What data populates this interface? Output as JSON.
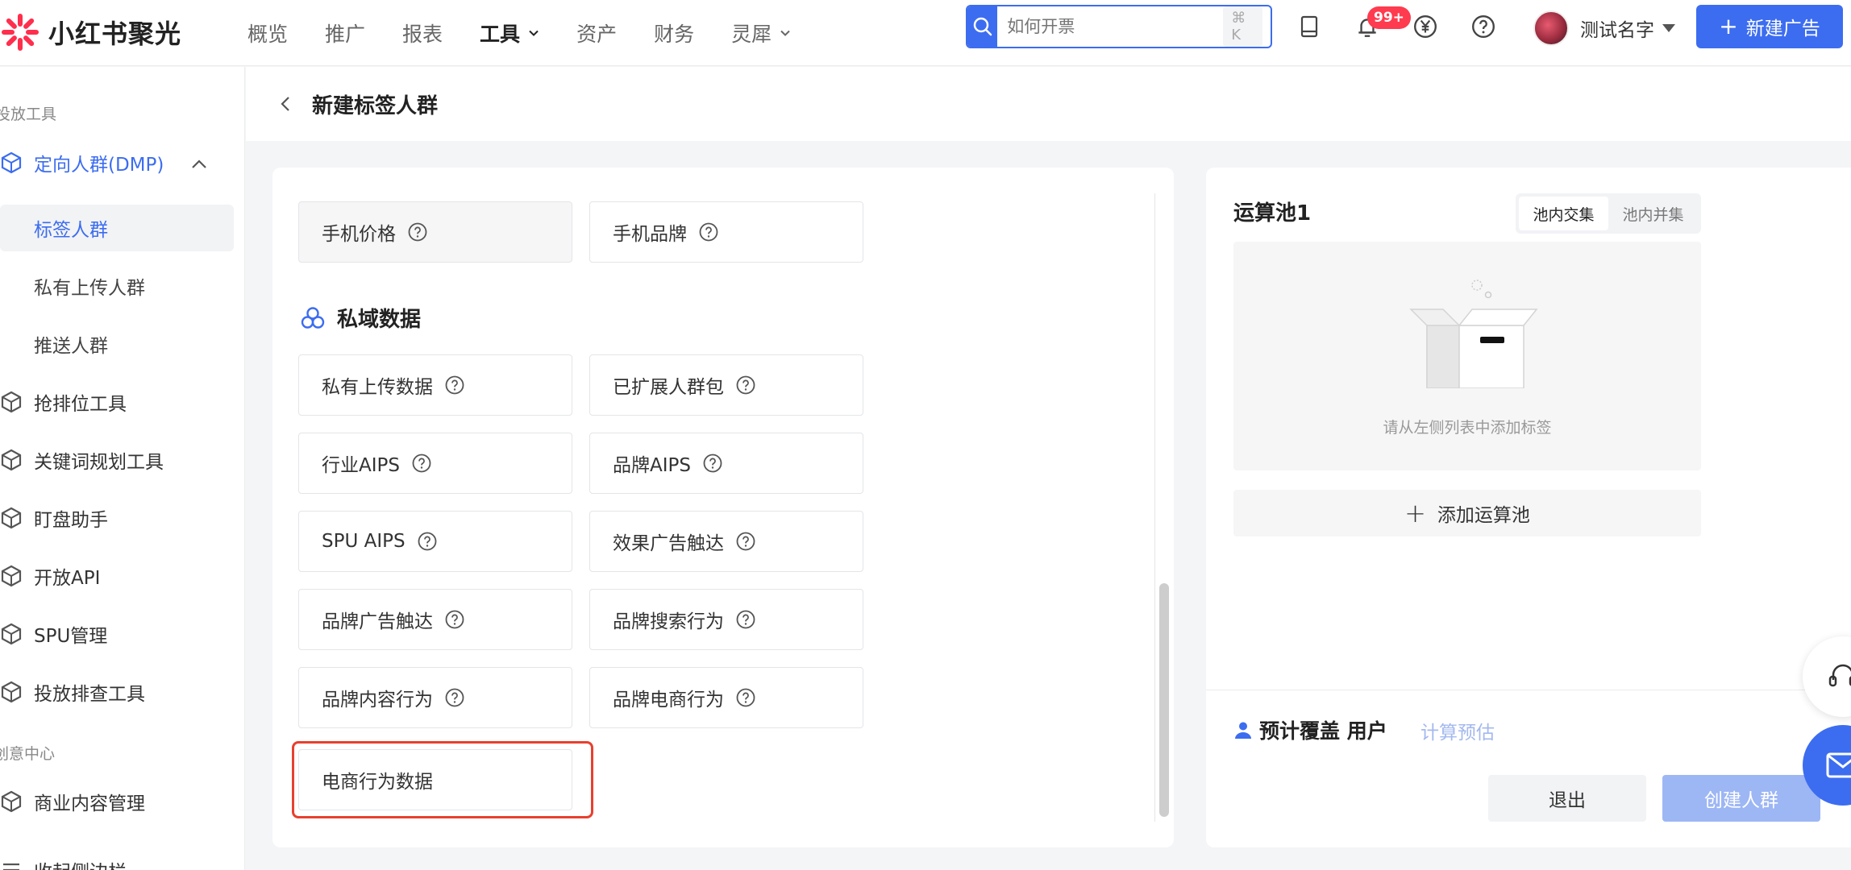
{
  "app": {
    "brand_name": "小红书聚光",
    "brand_color": "#ff2e4d",
    "accent_color": "#3c6df0"
  },
  "nav": {
    "items": [
      {
        "label": "概览"
      },
      {
        "label": "推广"
      },
      {
        "label": "报表"
      },
      {
        "label": "工具",
        "active": true,
        "has_dropdown": true
      },
      {
        "label": "资产"
      },
      {
        "label": "财务"
      },
      {
        "label": "灵犀",
        "has_dropdown": true
      }
    ]
  },
  "search": {
    "placeholder": "如何开票",
    "shortcut": "⌘ K"
  },
  "topbar": {
    "notification_badge": "99+",
    "icons": [
      "tablet-icon",
      "bell-icon",
      "yen-icon",
      "help-icon"
    ],
    "user_name": "测试名字",
    "new_ad_label": "新建广告"
  },
  "sidebar": {
    "section_delivery": "投放工具",
    "dmp_label": "定向人群(DMP)",
    "sub_items": [
      {
        "label": "标签人群",
        "selected": true
      },
      {
        "label": "私有上传人群"
      },
      {
        "label": "推送人群"
      }
    ],
    "tools": [
      {
        "label": "抢排位工具"
      },
      {
        "label": "关键词规划工具"
      },
      {
        "label": "盯盘助手"
      },
      {
        "label": "开放API"
      },
      {
        "label": "SPU管理"
      },
      {
        "label": "投放排查工具"
      }
    ],
    "section_creative": "创意中心",
    "content_mgmt": "商业内容管理",
    "collapse_label": "收起侧边栏"
  },
  "page": {
    "title": "新建标签人群"
  },
  "tags": {
    "top_row": [
      {
        "label": "手机价格",
        "has_help": true
      },
      {
        "label": "手机品牌",
        "has_help": true
      }
    ],
    "private_section_title": "私域数据",
    "private": [
      {
        "label": "私有上传数据",
        "has_help": true
      },
      {
        "label": "已扩展人群包",
        "has_help": true
      },
      {
        "label": "行业AIPS",
        "has_help": true
      },
      {
        "label": "品牌AIPS",
        "has_help": true
      },
      {
        "label": "SPU AIPS",
        "has_help": true
      },
      {
        "label": "效果广告触达",
        "has_help": true
      },
      {
        "label": "品牌广告触达",
        "has_help": true
      },
      {
        "label": "品牌搜索行为",
        "has_help": true
      },
      {
        "label": "品牌内容行为",
        "has_help": true
      },
      {
        "label": "品牌电商行为",
        "has_help": true
      },
      {
        "label": "电商行为数据",
        "has_help": false,
        "highlighted": true
      }
    ]
  },
  "pool": {
    "title": "运算池1",
    "modes": [
      {
        "label": "池内交集",
        "active": true
      },
      {
        "label": "池内并集"
      }
    ],
    "empty_text": "请从左侧列表中添加标签",
    "add_pool_label": "添加运算池",
    "coverage_label": "预计覆盖 用户",
    "calc_label": "计算预估",
    "exit_label": "退出",
    "create_label": "创建人群"
  }
}
